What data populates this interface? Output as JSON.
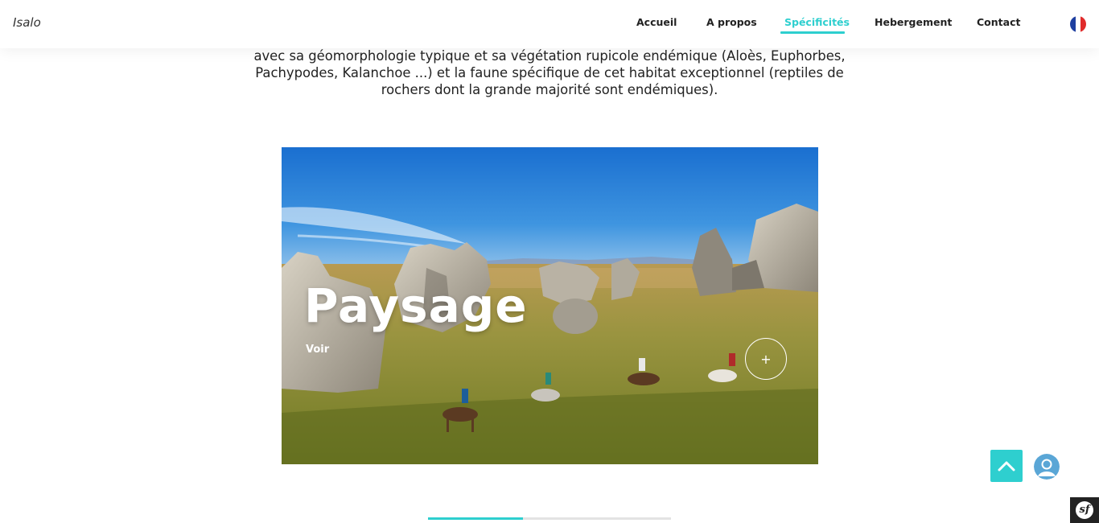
{
  "header": {
    "brand": "Isalo",
    "nav": [
      {
        "label": "Accueil",
        "active": false
      },
      {
        "label": "A propos",
        "active": false
      },
      {
        "label": "Spécificités",
        "active": true
      },
      {
        "label": "Hebergement",
        "active": false
      },
      {
        "label": "Contact",
        "active": false
      }
    ],
    "language_icon": "france-flag-icon"
  },
  "intro_lines": [
    "avec sa géomorphologie typique et sa végétation rupicole endémique (Aloès, Euphorbes,",
    "Pachypodes, Kalanchoe ...) et la faune spécifique de cet habitat exceptionnel (reptiles de",
    "rochers dont la grande majorité sont endémiques)."
  ],
  "slide": {
    "title": "Paysage",
    "link_label": "Voir",
    "plus_symbol": "+"
  },
  "slider": {
    "progress": 0.39
  },
  "widgets": {
    "scroll_top_icon": "chevron-up-icon",
    "avatar_icon": "user-avatar-icon",
    "debug_badge_icon": "symfony-icon",
    "debug_badge_text": "sf"
  },
  "colors": {
    "accent": "#2ecfcf",
    "text": "#222222",
    "flag_blue": "#1e3fa0",
    "flag_white": "#ffffff",
    "flag_red": "#e02b2b"
  }
}
